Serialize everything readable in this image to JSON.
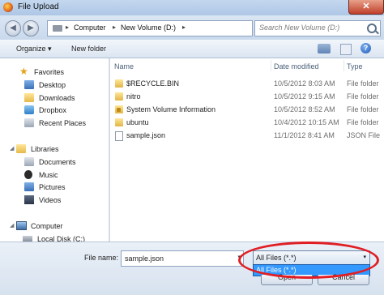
{
  "window": {
    "title": "File Upload",
    "close_glyph": "✕"
  },
  "navbar": {
    "back_glyph": "◀",
    "forward_glyph": "▶",
    "address": [
      "Computer",
      "New Volume (D:)"
    ],
    "separator": "▸",
    "search_placeholder": "Search New Volume (D:)"
  },
  "toolbar": {
    "organize": "Organize ▾",
    "new_folder": "New folder",
    "help_glyph": "?"
  },
  "sidebar": {
    "favorites": {
      "label": "Favorites",
      "items": [
        "Desktop",
        "Downloads",
        "Dropbox",
        "Recent Places"
      ]
    },
    "libraries": {
      "label": "Libraries",
      "items": [
        "Documents",
        "Music",
        "Pictures",
        "Videos"
      ]
    },
    "computer": {
      "label": "Computer",
      "items": [
        "Local Disk (C:)"
      ]
    },
    "expander_glyph": "◢"
  },
  "columns": {
    "name": "Name",
    "date_modified": "Date modified",
    "type": "Type"
  },
  "files": [
    {
      "name": "$RECYCLE.BIN",
      "date": "10/5/2012 8:03 AM",
      "type": "File folder",
      "icon": "folder-icon"
    },
    {
      "name": "nitro",
      "date": "10/5/2012 9:15 AM",
      "type": "File folder",
      "icon": "folder-icon"
    },
    {
      "name": "System Volume Information",
      "date": "10/5/2012 8:52 AM",
      "type": "File folder",
      "icon": "locked-folder-icon"
    },
    {
      "name": "ubuntu",
      "date": "10/4/2012 10:15 AM",
      "type": "File folder",
      "icon": "folder-icon"
    },
    {
      "name": "sample.json",
      "date": "11/1/2012 8:41 AM",
      "type": "JSON File",
      "icon": "document-icon"
    }
  ],
  "bottom": {
    "file_name_label": "File name:",
    "file_name_value": "sample.json",
    "dropdown_glyph": "▾",
    "filter_selected": "All Files (*.*)",
    "filter_options": [
      "All Files (*.*)"
    ],
    "open_label": "Open",
    "cancel_label": "Cancel"
  },
  "colors": {
    "selection_blue": "#3399ff",
    "annotation_red": "#e01e24"
  }
}
